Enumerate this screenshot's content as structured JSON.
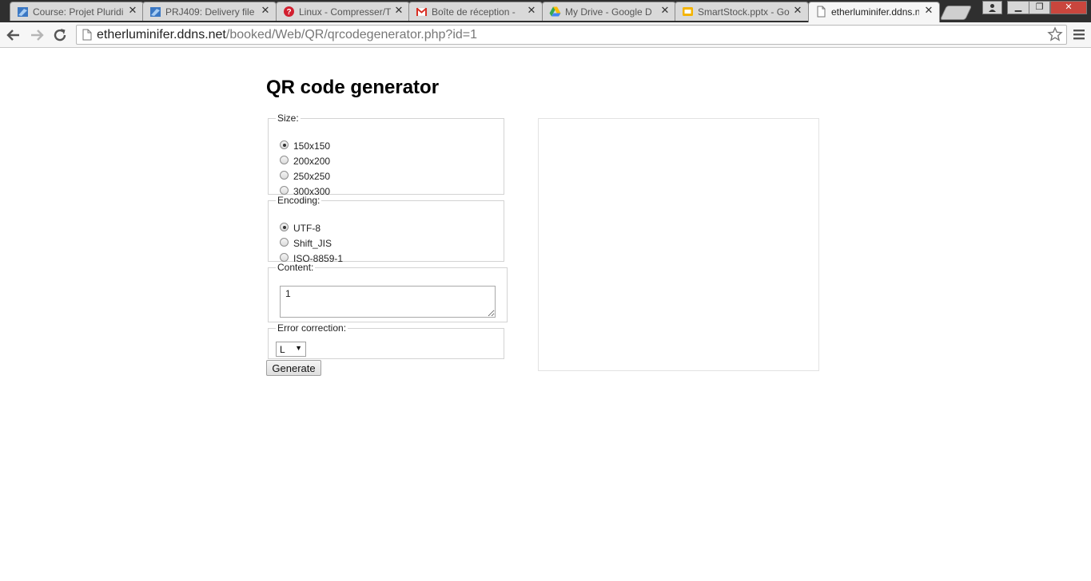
{
  "browser": {
    "tabs": [
      {
        "label": "Course: Projet Pluridi",
        "icon": "moodle-icon",
        "active": false
      },
      {
        "label": "PRJ409: Delivery file",
        "icon": "moodle-icon",
        "active": false
      },
      {
        "label": "Linux - Compresser/T",
        "icon": "site-icon",
        "active": false
      },
      {
        "label": "Boîte de réception - ",
        "icon": "gmail-icon",
        "active": false
      },
      {
        "label": "My Drive - Google D",
        "icon": "google-drive-icon",
        "active": false
      },
      {
        "label": "SmartStock.pptx - Go",
        "icon": "google-slides-icon",
        "active": false
      },
      {
        "label": "etherluminifer.ddns.n",
        "icon": "page-icon",
        "active": true
      }
    ],
    "url_host": "etherluminifer.ddns.net",
    "url_path": "/booked/Web/QR/qrcodegenerator.php?id=1",
    "accent": "#2f2f2f"
  },
  "page": {
    "title": "QR code generator",
    "size": {
      "legend": "Size:",
      "options": [
        "150x150",
        "200x200",
        "250x250",
        "300x300"
      ],
      "selected": "150x150"
    },
    "encoding": {
      "legend": "Encoding:",
      "options": [
        "UTF-8",
        "Shift_JIS",
        "ISO-8859-1"
      ],
      "selected": "UTF-8"
    },
    "content": {
      "legend": "Content:",
      "value": "1"
    },
    "error_correction": {
      "legend": "Error correction:",
      "selected": "L"
    },
    "generate_label": "Generate"
  }
}
